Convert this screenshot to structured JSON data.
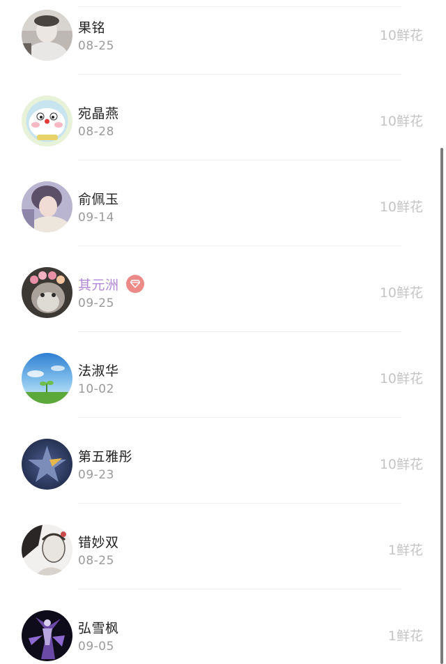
{
  "gift_list": {
    "items": [
      {
        "name": "果铭",
        "date": "08-25",
        "gift": "10鲜花",
        "vip": false,
        "avatar": "avatar-person-white-robe"
      },
      {
        "name": "宛晶燕",
        "date": "08-28",
        "gift": "10鲜花",
        "vip": false,
        "avatar": "avatar-cartoon-cat"
      },
      {
        "name": "俞佩玉",
        "date": "09-14",
        "gift": "10鲜花",
        "vip": false,
        "avatar": "avatar-person-purple"
      },
      {
        "name": "其元洲",
        "date": "09-25",
        "gift": "10鲜花",
        "vip": true,
        "avatar": "avatar-kitten-flower-crown"
      },
      {
        "name": "法淑华",
        "date": "10-02",
        "gift": "10鲜花",
        "vip": false,
        "avatar": "avatar-sprout-sky"
      },
      {
        "name": "第五雅彤",
        "date": "09-23",
        "gift": "10鲜花",
        "vip": false,
        "avatar": "avatar-star-logo"
      },
      {
        "name": "错妙双",
        "date": "08-25",
        "gift": "1鲜花",
        "vip": false,
        "avatar": "avatar-sketch-figure"
      },
      {
        "name": "弘雪枫",
        "date": "09-05",
        "gift": "1鲜花",
        "vip": false,
        "avatar": "avatar-fantasy-figure"
      }
    ]
  },
  "colors": {
    "name": "#222222",
    "vip_name": "#b187d6",
    "vip_badge": "#ec8a88",
    "date": "#9a9a9a",
    "gift": "#c4c4c4"
  },
  "icons": {
    "vip_badge": "diamond-icon"
  }
}
